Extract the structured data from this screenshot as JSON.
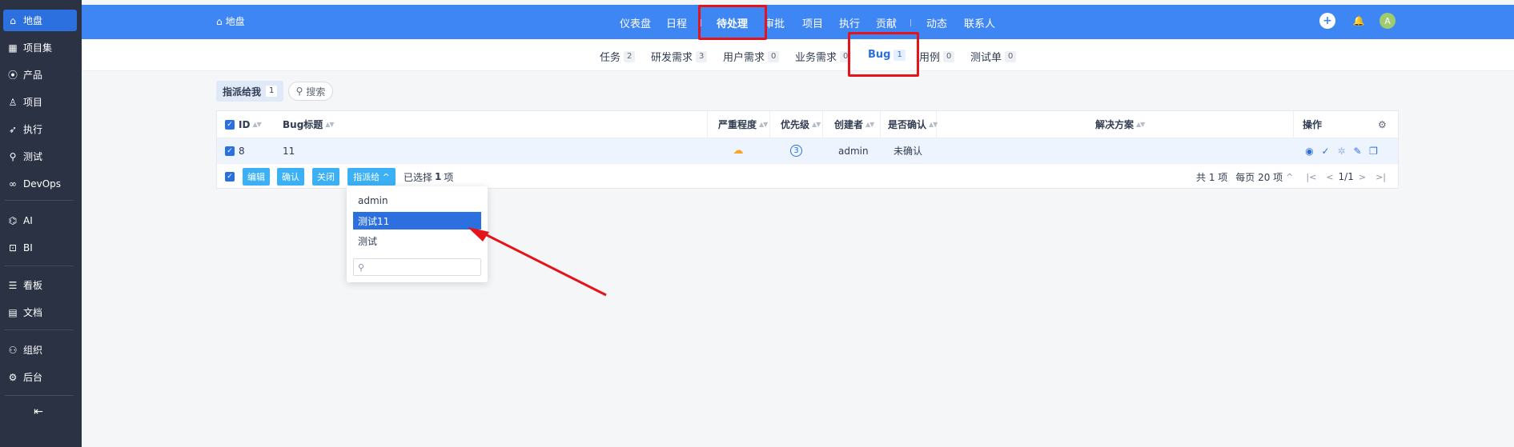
{
  "sidebar": {
    "items": [
      {
        "label": "地盘",
        "icon": "home-icon",
        "glyph": "⌂",
        "active": true
      },
      {
        "label": "项目集",
        "icon": "grid-icon",
        "glyph": "▦"
      },
      {
        "label": "产品",
        "icon": "location-pin-icon",
        "glyph": "⦿"
      },
      {
        "label": "项目",
        "icon": "user-icon",
        "glyph": "♙"
      },
      {
        "label": "执行",
        "icon": "rocket-icon",
        "glyph": "➶"
      },
      {
        "label": "测试",
        "icon": "search-icon",
        "glyph": "⚲"
      },
      {
        "label": "DevOps",
        "icon": "infinity-icon",
        "glyph": "∞"
      },
      {
        "label": "AI",
        "icon": "robot-icon",
        "glyph": "⌬"
      },
      {
        "label": "BI",
        "icon": "chart-board-icon",
        "glyph": "⊡"
      },
      {
        "label": "看板",
        "icon": "kanban-icon",
        "glyph": "☰"
      },
      {
        "label": "文档",
        "icon": "document-icon",
        "glyph": "▤"
      },
      {
        "label": "组织",
        "icon": "people-icon",
        "glyph": "⚇"
      },
      {
        "label": "后台",
        "icon": "gear-icon",
        "glyph": "⚙"
      }
    ],
    "collapse_glyph": "⇤"
  },
  "topbar": {
    "home_label": "地盘",
    "home_glyph": "⌂",
    "nav": [
      "仪表盘",
      "日程",
      "待处理",
      "审批",
      "项目",
      "执行",
      "贡献",
      "动态",
      "联系人"
    ],
    "add_glyph": "+",
    "bell_glyph": "🔔",
    "avatar": "A"
  },
  "subtabs": [
    {
      "label": "任务",
      "count": "2"
    },
    {
      "label": "研发需求",
      "count": "3"
    },
    {
      "label": "用户需求",
      "count": "0"
    },
    {
      "label": "业务需求",
      "count": "0"
    },
    {
      "label": "Bug",
      "count": "1"
    },
    {
      "label": "用例",
      "count": "0"
    },
    {
      "label": "测试单",
      "count": "0"
    }
  ],
  "filter": {
    "label": "指派给我",
    "count": "1",
    "search_label": "搜索",
    "search_glyph": "⚲"
  },
  "table": {
    "headers": {
      "id": "ID",
      "title": "Bug标题",
      "severity": "严重程度",
      "priority": "优先级",
      "creator": "创建者",
      "confirmed": "是否确认",
      "resolution": "解决方案",
      "actions": "操作"
    },
    "sort_glyph": "▲▼",
    "settings_glyph": "⚙",
    "check_glyph": "✓",
    "row": {
      "id": "8",
      "title": "11",
      "severity_glyph": "☁",
      "priority": "3",
      "creator": "admin",
      "confirmed": "未确认",
      "resolution": ""
    },
    "row_actions": [
      {
        "icon": "record-icon",
        "glyph": "◉"
      },
      {
        "icon": "confirm-icon",
        "glyph": "✓"
      },
      {
        "icon": "resolve-icon",
        "glyph": "✲"
      },
      {
        "icon": "edit-icon",
        "glyph": "✎"
      },
      {
        "icon": "copy-icon",
        "glyph": "❐"
      }
    ],
    "footer": {
      "buttons": [
        "编辑",
        "确认",
        "关闭",
        "指派给 ^"
      ],
      "selected_prefix": "已选择",
      "selected_count": "1",
      "selected_suffix": "项",
      "total": "共 1 项",
      "per_page": "每页 20 项",
      "per_page_glyph": "^",
      "first_glyph": "|<",
      "prev_glyph": "<",
      "page": "1/1",
      "next_glyph": ">",
      "last_glyph": ">|"
    }
  },
  "dropdown": {
    "items": [
      "admin",
      "测试11",
      "测试"
    ],
    "active_index": 1,
    "search_glyph": "⚲",
    "search_placeholder": ""
  }
}
